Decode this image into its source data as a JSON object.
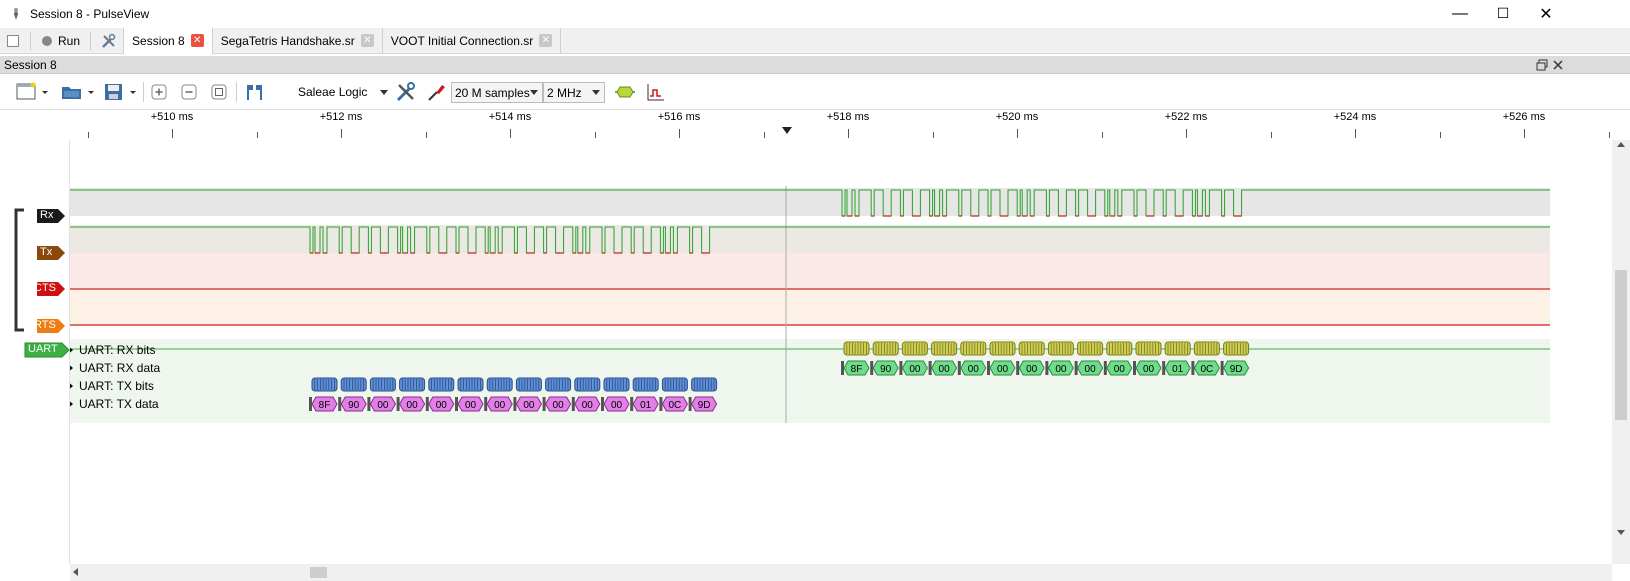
{
  "window": {
    "title": "Session 8 - PulseView",
    "minimize": "—",
    "maximize": "☐",
    "close": "✕"
  },
  "tabbar": {
    "run_label": "Run",
    "tabs": [
      {
        "label": "Session 8",
        "active": true
      },
      {
        "label": "SegaTetris Handshake.sr",
        "active": false
      },
      {
        "label": "VOOT Initial Connection.sr",
        "active": false
      }
    ]
  },
  "session": {
    "label": "Session 8"
  },
  "toolbar": {
    "device": "Saleae Logic",
    "samples": "20 M samples",
    "samplerate": "2 MHz"
  },
  "ruler": {
    "labels": [
      "+510 ms",
      "+512 ms",
      "+514 ms",
      "+516 ms",
      "+518 ms",
      "+520 ms",
      "+522 ms",
      "+524 ms",
      "+526 ms"
    ]
  },
  "channels": [
    {
      "name": "Rx",
      "color": "#1a1a1a"
    },
    {
      "name": "Tx",
      "color": "#8b4a0c"
    },
    {
      "name": "CTS",
      "color": "#cc1111"
    },
    {
      "name": "RTS",
      "color": "#f07c10"
    }
  ],
  "decoder": {
    "name": "UART",
    "color": "#3cb043",
    "rows": [
      "UART: RX bits",
      "UART: RX data",
      "UART: TX bits",
      "UART: TX data"
    ]
  },
  "rx_bytes": [
    "8F",
    "90",
    "00",
    "00",
    "00",
    "00",
    "00",
    "00",
    "00",
    "00",
    "00",
    "01",
    "0C",
    "9D"
  ],
  "tx_bytes": [
    "8F",
    "90",
    "00",
    "00",
    "00",
    "00",
    "00",
    "00",
    "00",
    "00",
    "00",
    "01",
    "0C",
    "9D"
  ]
}
